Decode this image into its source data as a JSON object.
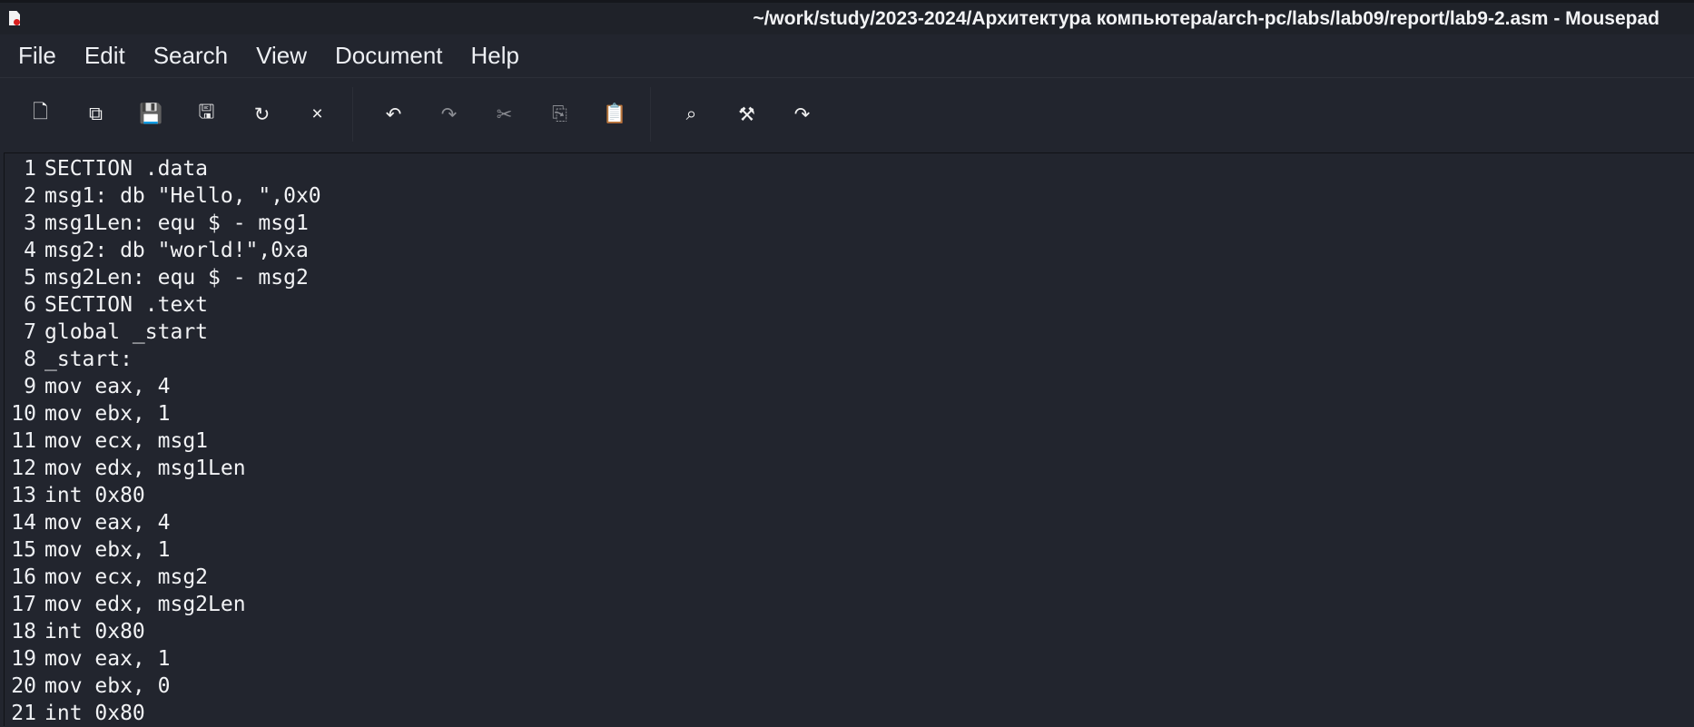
{
  "window": {
    "title": "~/work/study/2023-2024/Архитектура компьютера/arch-pc/labs/lab09/report/lab9-2.asm - Mousepad"
  },
  "menu": [
    "File",
    "Edit",
    "Search",
    "View",
    "Document",
    "Help"
  ],
  "toolbar": {
    "file_group": [
      {
        "name": "new-document",
        "glyph": "🗋"
      },
      {
        "name": "new-window",
        "glyph": "⧉"
      },
      {
        "name": "save",
        "glyph": "💾"
      },
      {
        "name": "save-as",
        "glyph": "🖫"
      },
      {
        "name": "reload",
        "glyph": "↻"
      },
      {
        "name": "close",
        "glyph": "×"
      }
    ],
    "edit_group": [
      {
        "name": "undo",
        "glyph": "↶"
      },
      {
        "name": "redo",
        "glyph": "↷"
      },
      {
        "name": "cut",
        "glyph": "✂"
      },
      {
        "name": "copy",
        "glyph": "⎘"
      },
      {
        "name": "paste",
        "glyph": "📋"
      }
    ],
    "search_group": [
      {
        "name": "find",
        "glyph": "⌕"
      },
      {
        "name": "find-replace",
        "glyph": "⚒"
      },
      {
        "name": "go-to-line",
        "glyph": "↷"
      }
    ]
  },
  "editor": {
    "lines": [
      "SECTION .data",
      "msg1: db \"Hello, \",0x0",
      "msg1Len: equ $ - msg1",
      "msg2: db \"world!\",0xa",
      "msg2Len: equ $ - msg2",
      "SECTION .text",
      "global _start",
      "_start:",
      "mov eax, 4",
      "mov ebx, 1",
      "mov ecx, msg1",
      "mov edx, msg1Len",
      "int 0x80",
      "mov eax, 4",
      "mov ebx, 1",
      "mov ecx, msg2",
      "mov edx, msg2Len",
      "int 0x80",
      "mov eax, 1",
      "mov ebx, 0",
      "int 0x80"
    ]
  }
}
